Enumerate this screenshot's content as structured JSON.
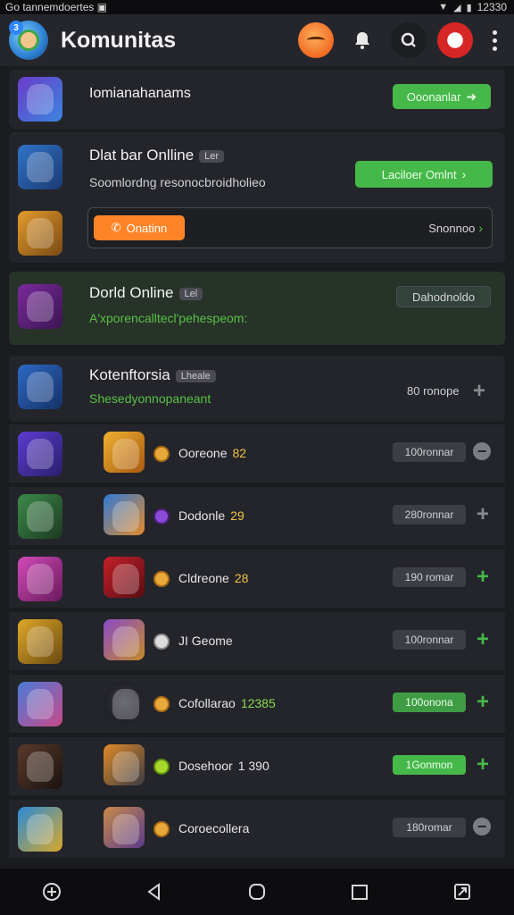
{
  "status_bar": {
    "left_text": "Go tannemdoertes ▣",
    "time": "12330",
    "icons": [
      "wifi-icon",
      "signal-icon",
      "battery-icon"
    ]
  },
  "header": {
    "title": "Komunitas"
  },
  "cards": {
    "top": {
      "title": "Iomianahanams",
      "button": "Ooonanlar"
    },
    "online1": {
      "title": "Dlat bar Onlline",
      "tag": "Ler",
      "subtitle": "Soomlordng resonocbroidholieo",
      "button": "Laciloer Omlnt",
      "input_button": "Onatinn",
      "input_right": "Snonnoo"
    },
    "online2": {
      "title": "Dorld Online",
      "tag": "Lel",
      "subtitle": "A'xporencalltecl'pehespeom:",
      "button": "Dahodnoldo"
    },
    "kontent": {
      "title": "Kotenftorsia",
      "tag": "Lheale",
      "subtitle": "Shesedyonnopaneant",
      "right_text": "80 ronope"
    }
  },
  "rows": [
    {
      "name": "Ooreone",
      "num": "82",
      "pill": "100ronnar",
      "pill_green": false,
      "action": "minus"
    },
    {
      "name": "Dodonle",
      "num": "29",
      "pill": "280ronnar",
      "pill_green": false,
      "action": "plus-gray"
    },
    {
      "name": "Cldreone",
      "num": "28",
      "pill": "190 romar",
      "pill_green": false,
      "action": "plus"
    },
    {
      "name": "JI Geome",
      "num": "",
      "pill": "100ronnar",
      "pill_green": false,
      "action": "plus"
    },
    {
      "name": "Cofollarao",
      "num": "12385",
      "pill": "100onona",
      "pill_green": true,
      "action": "plus"
    },
    {
      "name": "Dosehoor",
      "num": "1 390",
      "pill": "1Gonmon",
      "pill_green": true,
      "action": "plus"
    },
    {
      "name": "Coroecollera",
      "num": "",
      "pill": "180romar",
      "pill_green": false,
      "action": "minus"
    }
  ],
  "colors": {
    "accent_green": "#46b84a",
    "accent_orange": "#ff8428",
    "background": "#1b1c20",
    "card": "#24252a"
  }
}
